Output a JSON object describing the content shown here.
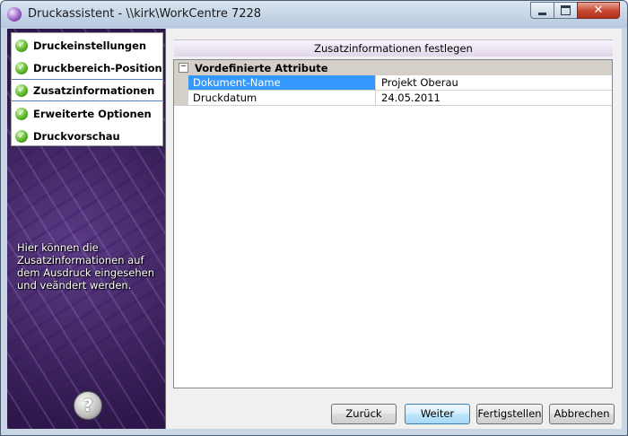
{
  "window": {
    "title": "Druckassistent - \\\\kirk\\WorkCentre 7228"
  },
  "title_controls": {
    "minimize_icon": "minimize-icon",
    "maximize_icon": "maximize-icon",
    "close_icon": "close-icon"
  },
  "steps": [
    {
      "label": "Druckeinstellungen",
      "icon": "green-check-icon",
      "active": false
    },
    {
      "label": "Druckbereich-Position",
      "icon": "green-check-icon",
      "active": false
    },
    {
      "label": "Zusatzinformationen",
      "icon": "green-check-icon",
      "active": true
    },
    {
      "label": "Erweiterte Optionen",
      "icon": "green-check-icon",
      "active": false
    },
    {
      "label": "Druckvorschau",
      "icon": "green-check-icon",
      "active": false
    }
  ],
  "help": {
    "description": "Hier können die Zusatzinformationen auf dem Ausdruck eingesehen und veändert werden.",
    "button_symbol": "?"
  },
  "page": {
    "heading": "Zusatzinformationen festlegen"
  },
  "grid": {
    "category": {
      "label": "Vordefinierte Attribute",
      "expander": "−"
    },
    "rows": [
      {
        "name": "Dokument-Name",
        "value": "Projekt Oberau",
        "selected": true
      },
      {
        "name": "Druckdatum",
        "value": "24.05.2011",
        "selected": false
      }
    ]
  },
  "buttons": {
    "back": "Zurück",
    "next": "Weiter",
    "finish": "Fertigstellen",
    "cancel": "Abbrechen"
  },
  "colors": {
    "selection": "#3399ff",
    "check_green": "#55b223",
    "sidebar_purple": "#4a2d73"
  }
}
